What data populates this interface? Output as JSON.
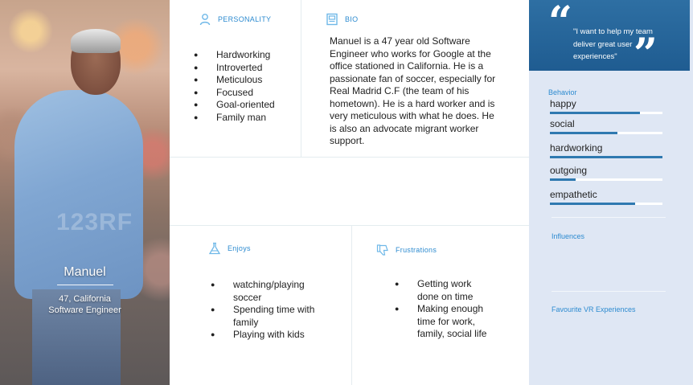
{
  "profile": {
    "name": "Manuel",
    "age_location": "47, California",
    "role": "Software Engineer",
    "watermark": "123RF"
  },
  "personality": {
    "label": "PERSONALITY",
    "items": [
      "Hardworking",
      "Introverted",
      "Meticulous",
      "Focused",
      "Goal-oriented",
      "Family man"
    ]
  },
  "bio": {
    "label": "BIO",
    "text": "Manuel is a 47 year old Software Engineer who works for Google at the office stationed in California. He is a passionate fan of soccer, especially for Real Madrid C.F (the team of his hometown). He is a hard worker and is very meticulous with what he does. He is also an advocate migrant worker support."
  },
  "enjoys": {
    "label": "Enjoys",
    "items": [
      "watching/playing soccer",
      "Spending time with family",
      "Playing with kids"
    ]
  },
  "frustrations": {
    "label": "Frustrations",
    "items": [
      "Getting work done on time",
      "Making enough time for work, family, social life"
    ]
  },
  "quote": {
    "text": "\"I want to help my team deliver great user experiences\""
  },
  "behavior": {
    "label": "Behavior",
    "traits": [
      {
        "name": "happy",
        "level": 0.8
      },
      {
        "name": "social",
        "level": 0.6
      },
      {
        "name": "hardworking",
        "level": 1.0
      },
      {
        "name": "outgoing",
        "level": 0.23
      },
      {
        "name": "empathetic",
        "level": 0.76
      }
    ]
  },
  "influences": {
    "label": "Influences"
  },
  "favourite_vr": {
    "label": "Favourite VR Experiences"
  },
  "colors": {
    "accent": "#2d8bd0",
    "quote_bg": "#1f5c91",
    "sidebar_bg": "#dfe7f4",
    "bar_fill": "#2f79b0"
  }
}
